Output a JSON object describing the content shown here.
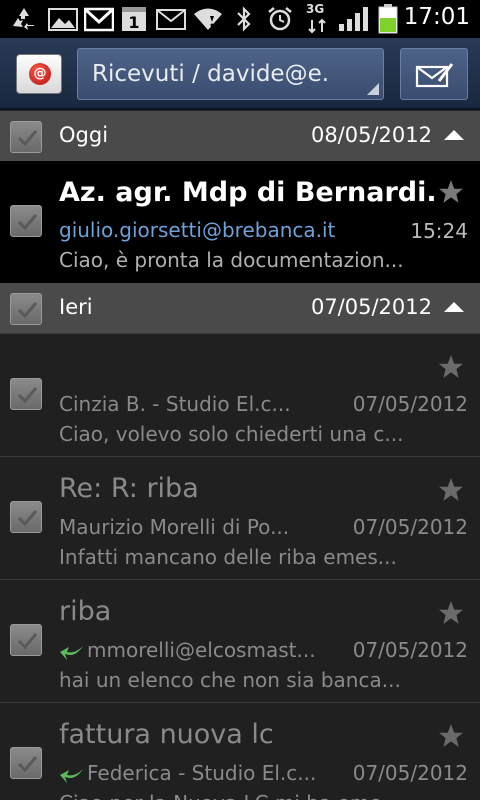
{
  "status_bar": {
    "time": "17:01",
    "network": "3G",
    "icons": [
      "recycle-icon",
      "image-icon",
      "gmail-icon",
      "calendar-icon",
      "mail-icon",
      "wifi-icon",
      "bluetooth-icon",
      "alarm-icon",
      "signal-icon",
      "battery-icon"
    ],
    "calendar_day": "1"
  },
  "action_bar": {
    "account_label": "Ricevuti / davide@e.",
    "app_icon": "email-app-icon",
    "compose_icon": "compose-icon"
  },
  "sections": [
    {
      "label": "Oggi",
      "date": "08/05/2012"
    },
    {
      "label": "Ieri",
      "date": "07/05/2012"
    }
  ],
  "emails": [
    {
      "subject": "Az. agr. Mdp di Bernardi...",
      "from": "giulio.giorsetti@brebanca.it",
      "time": "15:24",
      "preview": "Ciao, è pronta la documentazion...",
      "unread": true,
      "replied": false
    },
    {
      "subject": "",
      "from": "Cinzia B. - Studio El.c...",
      "time": "07/05/2012",
      "preview": "Ciao, volevo solo chiederti una c...",
      "unread": false,
      "replied": false
    },
    {
      "subject": "Re: R: riba",
      "from": "Maurizio Morelli di Po...",
      "time": "07/05/2012",
      "preview": "Infatti mancano delle riba emes...",
      "unread": false,
      "replied": false
    },
    {
      "subject": "riba",
      "from": "mmorelli@elcosmast...",
      "time": "07/05/2012",
      "preview": "hai un elenco che non sia banca...",
      "unread": false,
      "replied": true
    },
    {
      "subject": "fattura nuova lc",
      "from": "Federica - Studio El.c...",
      "time": "07/05/2012",
      "preview": "Ciao per la Nuova LC mi ha eme...",
      "unread": false,
      "replied": true
    }
  ],
  "colors": {
    "unread_from": "#6fa0d8",
    "read_text": "#8a8a8a",
    "unread_preview": "#b0b0b0",
    "section_bg": "#4a4a4a",
    "reply_arrow": "#5cb85c"
  }
}
